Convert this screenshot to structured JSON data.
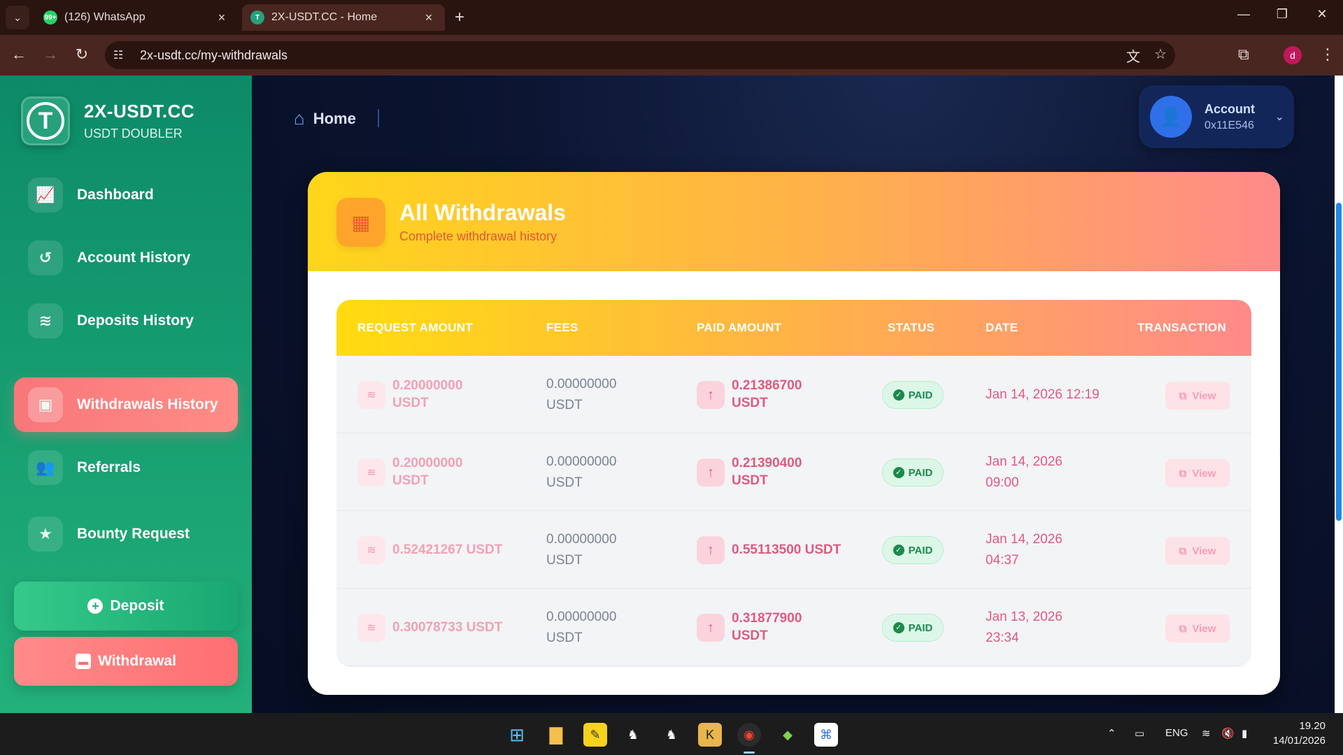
{
  "browser": {
    "tabs": [
      {
        "title": "(126) WhatsApp",
        "badge": "99+"
      },
      {
        "title": "2X-USDT.CC - Home",
        "active": true
      }
    ],
    "url": "2x-usdt.cc/my-withdrawals",
    "profile_initial": "d"
  },
  "brand": {
    "name": "2X-USDT.CC",
    "subtitle": "USDT DOUBLER",
    "logo_letter": "T"
  },
  "sidebar": {
    "items": [
      {
        "label": "Dashboard",
        "icon": "chart-line-icon"
      },
      {
        "label": "Account History",
        "icon": "history-icon"
      },
      {
        "label": "Deposits History",
        "icon": "coins-stack-icon"
      },
      {
        "label": "Withdrawals History",
        "icon": "wallet-icon",
        "active": true
      },
      {
        "label": "Referrals",
        "icon": "users-icon"
      },
      {
        "label": "Bounty Request",
        "icon": "star-icon"
      }
    ],
    "deposit_label": "Deposit",
    "withdrawal_label": "Withdrawal"
  },
  "topbar": {
    "home_label": "Home",
    "account_label": "Account",
    "account_address": "0x11E546"
  },
  "card": {
    "title": "All Withdrawals",
    "subtitle": "Complete withdrawal history"
  },
  "table": {
    "headers": [
      "REQUEST AMOUNT",
      "FEES",
      "PAID AMOUNT",
      "STATUS",
      "DATE",
      "TRANSACTION"
    ],
    "rows": [
      {
        "request_l1": "0.20000000",
        "request_l2": "USDT",
        "fees_l1": "0.00000000",
        "fees_l2": "USDT",
        "paid_l1": "0.21386700",
        "paid_l2": "USDT",
        "status": "PAID",
        "date_l1": "Jan 14, 2026 12:19",
        "date_l2": "",
        "action": "View"
      },
      {
        "request_l1": "0.20000000",
        "request_l2": "USDT",
        "fees_l1": "0.00000000",
        "fees_l2": "USDT",
        "paid_l1": "0.21390400",
        "paid_l2": "USDT",
        "status": "PAID",
        "date_l1": "Jan 14, 2026",
        "date_l2": "09:00",
        "action": "View"
      },
      {
        "request_l1": "0.52421267 USDT",
        "request_l2": "",
        "fees_l1": "0.00000000",
        "fees_l2": "USDT",
        "paid_l1": "0.55113500 USDT",
        "paid_l2": "",
        "status": "PAID",
        "date_l1": "Jan 14, 2026",
        "date_l2": "04:37",
        "action": "View"
      },
      {
        "request_l1": "0.30078733 USDT",
        "request_l2": "",
        "fees_l1": "0.00000000",
        "fees_l2": "USDT",
        "paid_l1": "0.31877900",
        "paid_l2": "USDT",
        "status": "PAID",
        "date_l1": "Jan 13, 2026",
        "date_l2": "23:34",
        "action": "View"
      }
    ]
  },
  "taskbar": {
    "language": "ENG",
    "time": "19.20",
    "date": "14/01/2026"
  },
  "colors": {
    "sidebar_green": "#149a6f",
    "active_pink": "#ff7f7f",
    "header_gradient_start": "#ffd61a",
    "header_gradient_end": "#ff8a8a",
    "status_green": "#1b8a4c"
  }
}
